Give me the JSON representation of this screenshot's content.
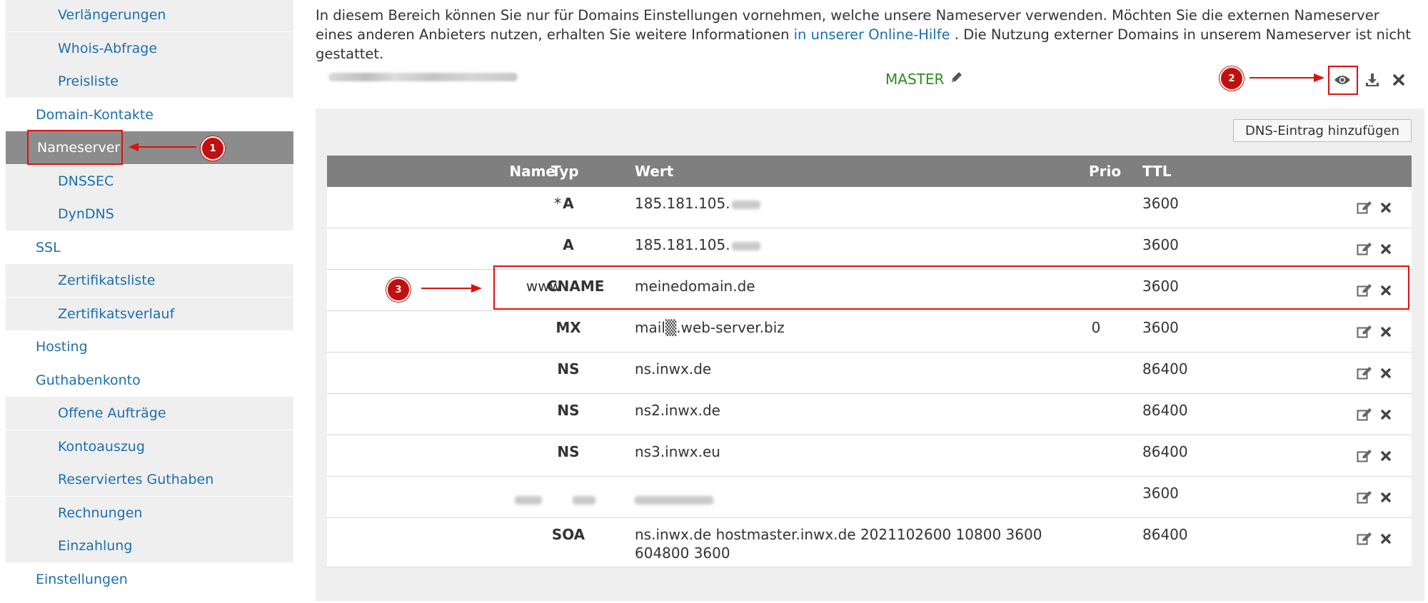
{
  "sidebar": {
    "items": [
      {
        "label": "Verlängerungen",
        "level": "sub"
      },
      {
        "label": "Whois-Abfrage",
        "level": "sub"
      },
      {
        "label": "Preisliste",
        "level": "sub"
      },
      {
        "label": "Domain-Kontakte",
        "level": "top"
      },
      {
        "label": "Nameserver",
        "level": "active"
      },
      {
        "label": "DNSSEC",
        "level": "sub"
      },
      {
        "label": "DynDNS",
        "level": "sub"
      },
      {
        "label": "SSL",
        "level": "top"
      },
      {
        "label": "Zertifikatsliste",
        "level": "sub"
      },
      {
        "label": "Zertifikatsverlauf",
        "level": "sub"
      },
      {
        "label": "Hosting",
        "level": "top"
      },
      {
        "label": "Guthabenkonto",
        "level": "top"
      },
      {
        "label": "Offene Aufträge",
        "level": "sub"
      },
      {
        "label": "Kontoauszug",
        "level": "sub"
      },
      {
        "label": "Reserviertes Guthaben",
        "level": "sub"
      },
      {
        "label": "Rechnungen",
        "level": "sub"
      },
      {
        "label": "Einzahlung",
        "level": "sub"
      },
      {
        "label": "Einstellungen",
        "level": "top"
      }
    ]
  },
  "intro": {
    "text_before": "In diesem Bereich können Sie nur für Domains Einstellungen vornehmen, welche unsere Nameserver verwenden. Möchten Sie die externen Nameserver eines anderen Anbieters nutzen, erhalten Sie weitere Informationen ",
    "link": "in unserer Online-Hilfe",
    "text_after": " . Die Nutzung externer Domains in unserem Nameserver ist nicht gestattet."
  },
  "domain": {
    "mode": "MASTER"
  },
  "toolbar": {
    "add_dns_label": "DNS-Eintrag hinzufügen"
  },
  "table": {
    "headers": {
      "name": "Name",
      "type": "Typ",
      "value": "Wert",
      "prio": "Prio",
      "ttl": "TTL"
    },
    "rows": [
      {
        "name": "*",
        "type": "A",
        "value": "185.181.105.",
        "prio": "",
        "ttl": "3600",
        "blur_value": true
      },
      {
        "name": "",
        "type": "A",
        "value": "185.181.105.",
        "prio": "",
        "ttl": "3600",
        "blur_value": true
      },
      {
        "name": "www",
        "type": "CNAME",
        "value": "meinedomain.de",
        "prio": "",
        "ttl": "3600"
      },
      {
        "name": "",
        "type": "MX",
        "value": "mail▒.web-server.biz",
        "prio": "0",
        "ttl": "3600"
      },
      {
        "name": "",
        "type": "NS",
        "value": "ns.inwx.de",
        "prio": "",
        "ttl": "86400"
      },
      {
        "name": "",
        "type": "NS",
        "value": "ns2.inwx.de",
        "prio": "",
        "ttl": "86400"
      },
      {
        "name": "",
        "type": "NS",
        "value": "ns3.inwx.eu",
        "prio": "",
        "ttl": "86400"
      },
      {
        "name": "",
        "type": "",
        "value": "",
        "prio": "",
        "ttl": "3600",
        "redacted": true
      },
      {
        "name": "",
        "type": "SOA",
        "value": "ns.inwx.de hostmaster.inwx.de 2021102600 10800 3600 604800 3600",
        "prio": "",
        "ttl": "86400"
      }
    ]
  },
  "annotations": {
    "badge_1": "1",
    "badge_2": "2",
    "badge_3": "3",
    "color": "#cc1111"
  },
  "colors": {
    "link": "#1a6fb0",
    "active_nav": "#8c8c8c",
    "table_header": "#7f7f7f",
    "master_text": "#2e8b20"
  }
}
